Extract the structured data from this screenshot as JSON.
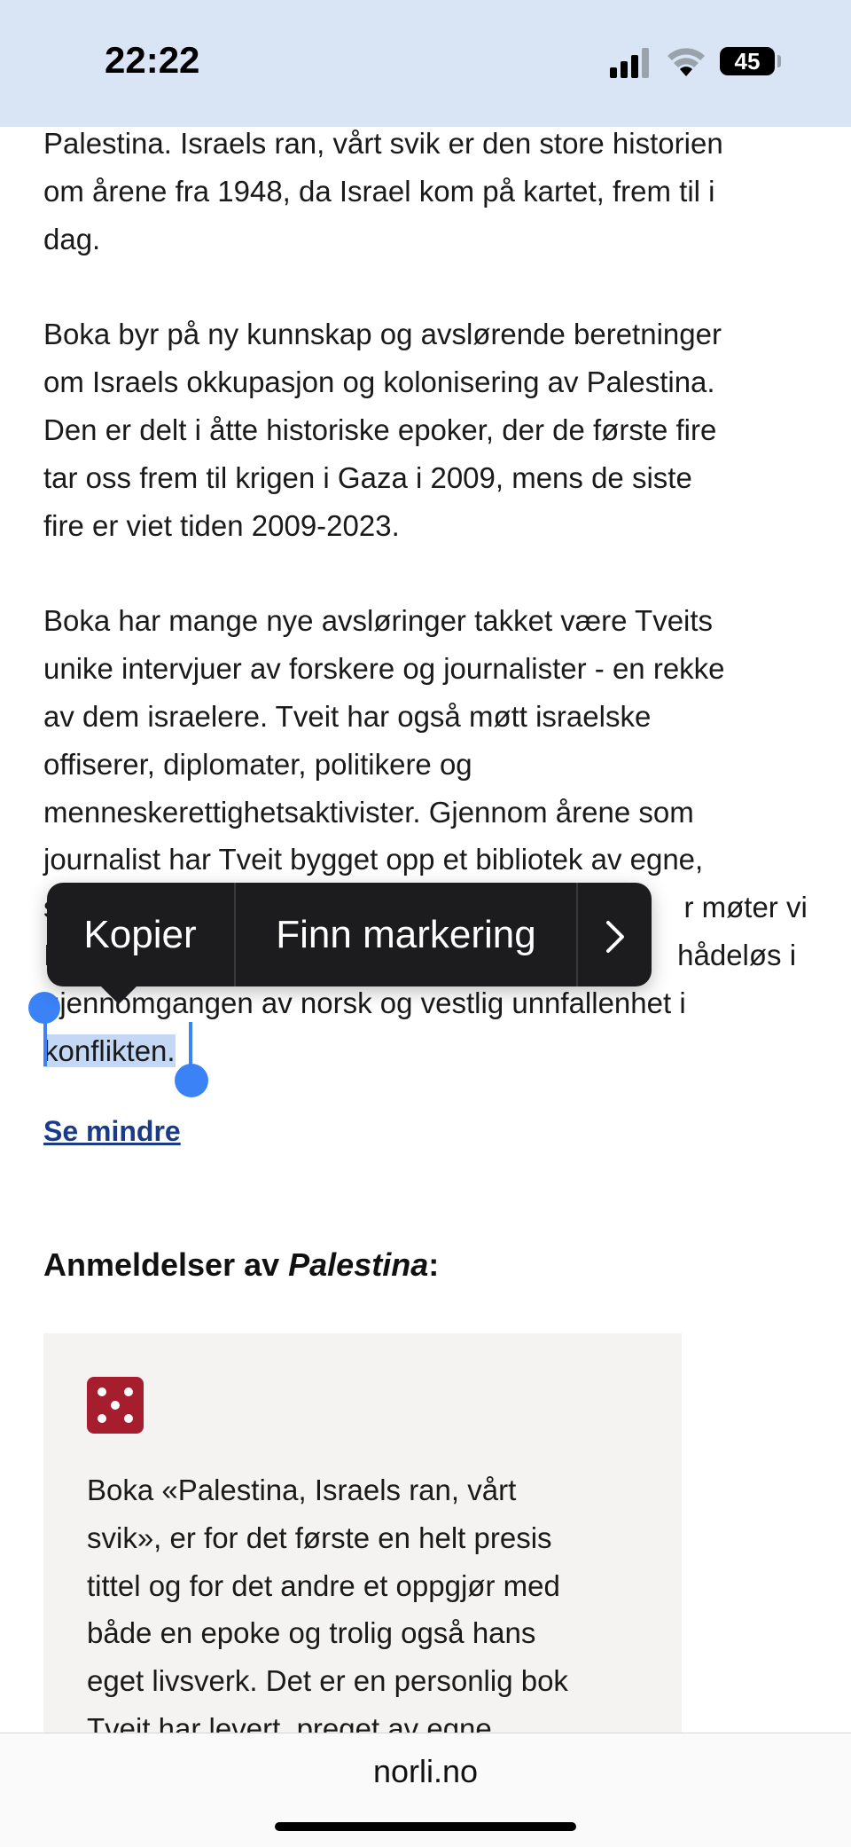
{
  "status": {
    "time": "22:22",
    "battery_level": "45",
    "signal_icon": "cellular-signal-icon",
    "wifi_icon": "wifi-icon"
  },
  "article": {
    "para1_lines": [
      "Palestina. Israels ran, vårt svik er den store historien",
      "om årene fra 1948, da Israel kom på kartet, frem til i",
      "dag."
    ],
    "para2_lines": [
      "Boka byr på ny kunnskap og avslørende beretninger",
      "om Israels okkupasjon og kolonisering av Palestina.",
      "Den er delt i åtte historiske epoker, der de første fire",
      "tar oss frem til krigen i Gaza i 2009, mens de siste",
      "fire er viet tiden 2009-2023."
    ],
    "para3_lines": [
      "Boka har mange nye avsløringer takket være Tveits",
      "unike intervjuer av forskere og journalister - en rekke",
      "av dem israelere. Tveit har også møtt israelske",
      "offiserer, diplomater, politikere og",
      "menneskerettighetsaktivister. Gjennom årene som",
      "journalist har Tveit bygget opp et bibliotek av egne,",
      "s                                                                             r møter vi",
      "I                                                                             hådeløs i",
      "gjennomgangen av norsk og vestlig unnfallenhet i"
    ],
    "selected_text": "konflikten.",
    "see_less_label": "Se mindre"
  },
  "reviews": {
    "title_prefix": "Anmeldelser av ",
    "title_italic": "Palestina",
    "title_suffix": ":",
    "dice_icon": "dice-five-icon",
    "review_lines": [
      "Boka «Palestina, Israels ran, vårt",
      "svik», er for det første en helt presis",
      "tittel og for det andre et oppgjør med",
      "både en epoke og trolig også hans",
      "eget livsverk. Det er en personlig bok",
      "Tveit har levert, preget av egne"
    ]
  },
  "edit_menu": {
    "copy_label": "Kopier",
    "find_selection_label": "Finn markering",
    "more_icon": "chevron-right-icon"
  },
  "browser": {
    "url": "norli.no"
  }
}
